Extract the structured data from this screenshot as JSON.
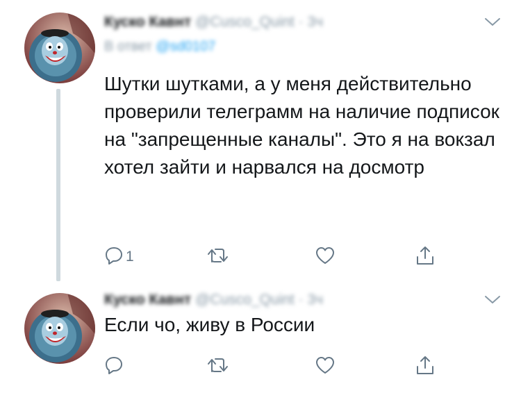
{
  "tweets": [
    {
      "author_name": "Куско Кавнт",
      "handle": "@Cusco_Quint",
      "separator": "·",
      "time": "3ч",
      "reply_label": "В ответ",
      "reply_mention": "@sd0107",
      "text": "Шутки шутками, а у меня действительно проверили телеграмм на наличие подписок на \"запрещенные каналы\". Это я на вокзал хотел зайти и нарвался на досмотр",
      "reply_count": "1"
    },
    {
      "author_name": "Куско Кавнт",
      "handle": "@Cusco_Quint",
      "separator": "·",
      "time": "3ч",
      "text": "Если чо, живу в России",
      "reply_count": ""
    }
  ],
  "icons": {
    "reply": "reply-icon",
    "retweet": "retweet-icon",
    "like": "like-icon",
    "share": "share-icon",
    "menu": "chevron-down-icon"
  },
  "colors": {
    "text": "#14171a",
    "secondary": "#8899a6",
    "icon": "#657786",
    "mention": "#1da1f2",
    "thread_line": "#cfd9de"
  }
}
